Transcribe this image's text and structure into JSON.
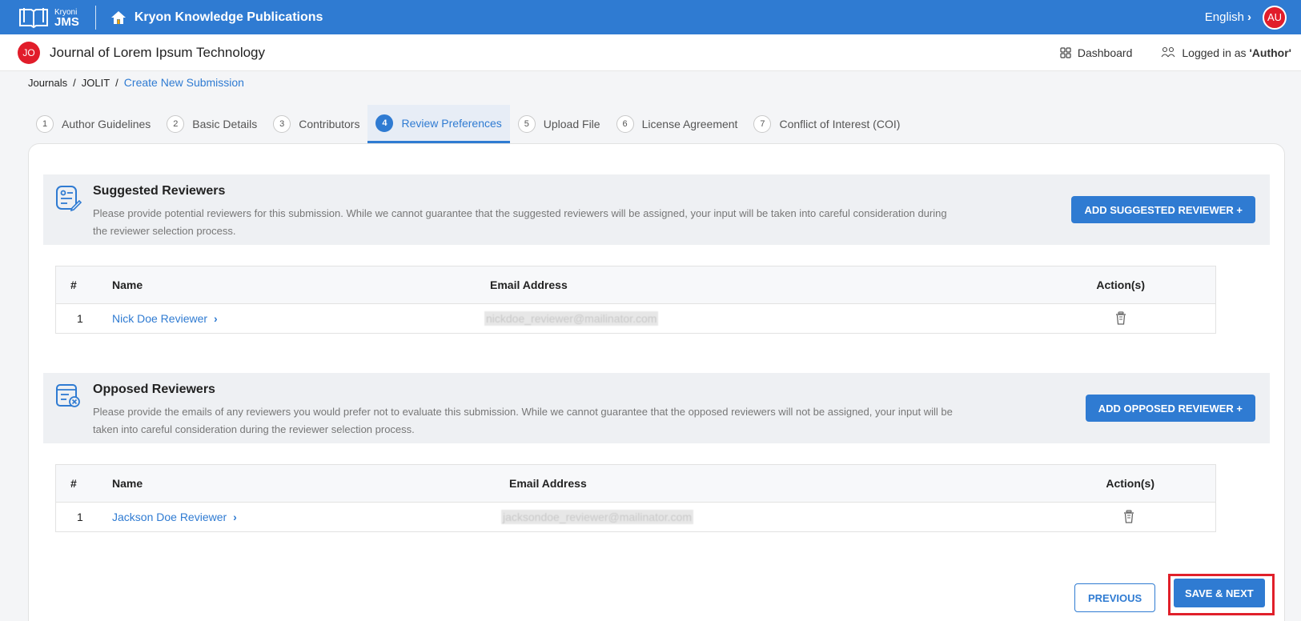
{
  "app": {
    "logo_small": "Kryoni",
    "logo_big": "JMS",
    "title": "Kryon Knowledge Publications",
    "language": "English",
    "user_initials": "AU"
  },
  "journal": {
    "initials": "JO",
    "title": "Journal of Lorem Ipsum Technology",
    "dashboard_label": "Dashboard",
    "logged_in_prefix": "Logged in as ",
    "logged_in_role": "'Author'"
  },
  "breadcrumb": {
    "items": [
      "Journals",
      "JOLIT"
    ],
    "current": "Create New Submission"
  },
  "steps": [
    {
      "num": "1",
      "label": "Author Guidelines"
    },
    {
      "num": "2",
      "label": "Basic Details"
    },
    {
      "num": "3",
      "label": "Contributors"
    },
    {
      "num": "4",
      "label": "Review Preferences"
    },
    {
      "num": "5",
      "label": "Upload File"
    },
    {
      "num": "6",
      "label": "License Agreement"
    },
    {
      "num": "7",
      "label": "Conflict of Interest (COI)"
    }
  ],
  "suggested": {
    "title": "Suggested Reviewers",
    "description": "Please provide potential reviewers for this submission. While we cannot guarantee that the suggested reviewers will be assigned, your input will be taken into careful consideration during the reviewer selection process.",
    "add_button": "ADD SUGGESTED REVIEWER +",
    "columns": {
      "num": "#",
      "name": "Name",
      "email": "Email Address",
      "actions": "Action(s)"
    },
    "rows": [
      {
        "num": "1",
        "name": "Nick Doe Reviewer",
        "email": "nickdoe_reviewer@mailinator.com"
      }
    ]
  },
  "opposed": {
    "title": "Opposed Reviewers",
    "description": "Please provide the emails of any reviewers you would prefer not to evaluate this submission. While we cannot guarantee that the opposed reviewers will not be assigned, your input will be taken into careful consideration during the reviewer selection process.",
    "add_button": "ADD OPPOSED REVIEWER +",
    "columns": {
      "num": "#",
      "name": "Name",
      "email": "Email Address",
      "actions": "Action(s)"
    },
    "rows": [
      {
        "num": "1",
        "name": "Jackson Doe Reviewer",
        "email": "jacksondoe_reviewer@mailinator.com"
      }
    ]
  },
  "footer": {
    "previous": "PREVIOUS",
    "save_next": "SAVE & NEXT"
  },
  "colors": {
    "primary": "#2f7bd2",
    "avatar_red": "#e11d2a",
    "highlight": "#e0202a"
  }
}
